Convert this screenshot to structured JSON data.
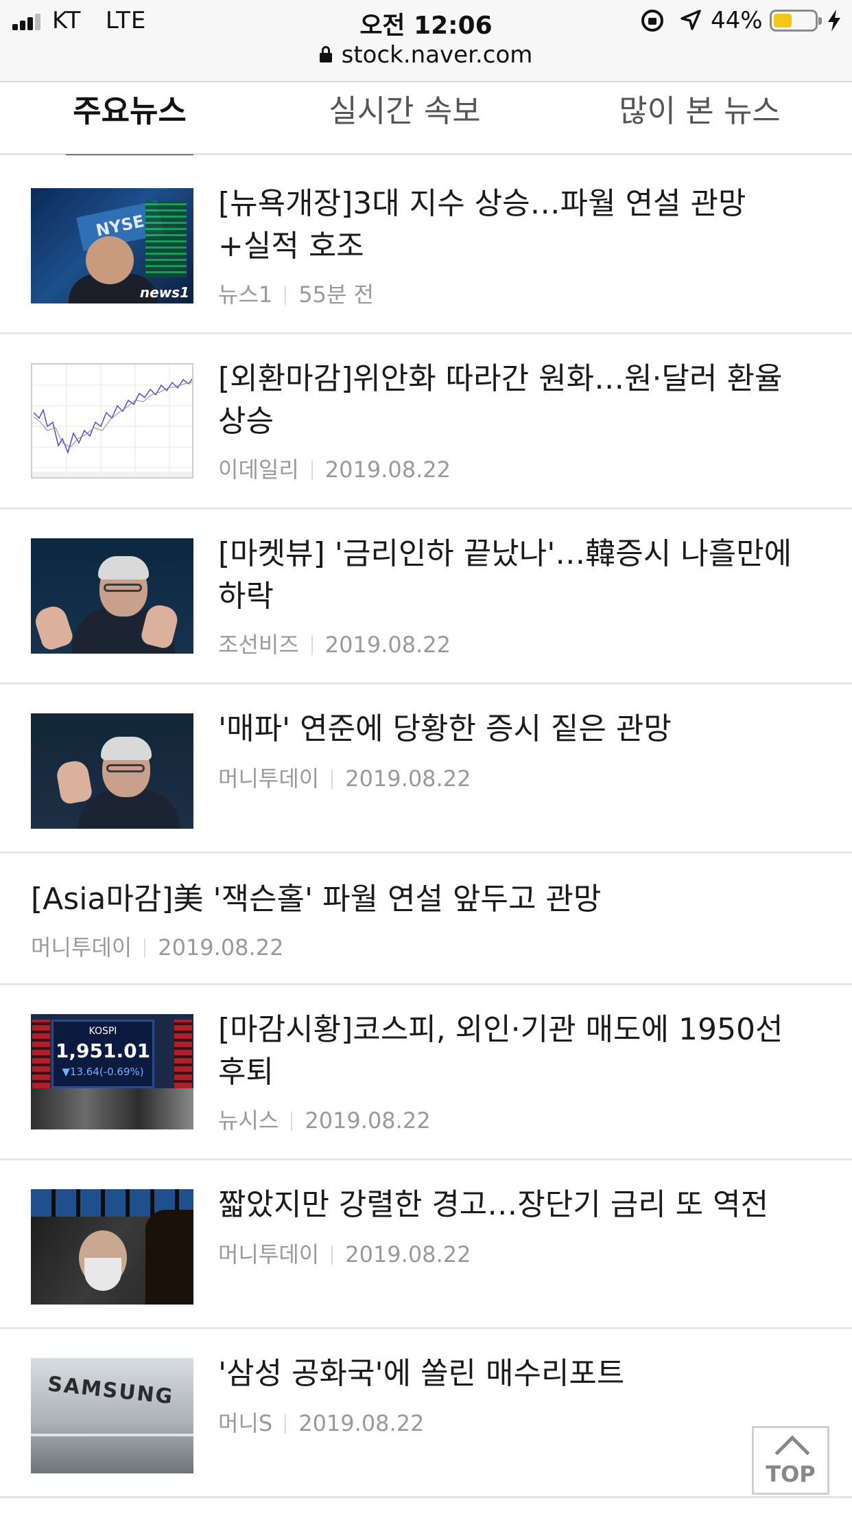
{
  "status_bar": {
    "carrier": "KT",
    "network": "LTE",
    "time": "오전 12:06",
    "battery": "44%",
    "battery_level": 0.44,
    "icons": [
      "signal-icon",
      "orientation-lock-icon",
      "location-icon",
      "battery-icon",
      "charging-bolt-icon"
    ]
  },
  "url_bar": {
    "url": "stock.naver.com",
    "icon": "lock-icon"
  },
  "tabs": [
    {
      "label": "주요뉴스",
      "active": true
    },
    {
      "label": "실시간 속보",
      "active": false
    },
    {
      "label": "많이 본 뉴스",
      "active": false
    }
  ],
  "news": [
    {
      "title": "[뉴욕개장]3대 지수 상승…파월 연설 관망+실적 호조",
      "source": "뉴스1",
      "time": "55분 전",
      "thumb_logo": "news1"
    },
    {
      "title": "[외환마감]위안화 따라간 원화…원·달러 환율 상승",
      "source": "이데일리",
      "time": "2019.08.22"
    },
    {
      "title": "[마켓뷰] '금리인하 끝났나'…韓증시 나흘만에 하락",
      "source": "조선비즈",
      "time": "2019.08.22"
    },
    {
      "title": "'매파' 연준에 당황한 증시 짙은 관망",
      "source": "머니투데이",
      "time": "2019.08.22"
    },
    {
      "title": "[Asia마감]美 '잭슨홀' 파월 연설 앞두고 관망",
      "source": "머니투데이",
      "time": "2019.08.22"
    },
    {
      "title": "[마감시황]코스피, 외인·기관 매도에 1950선 후퇴",
      "source": "뉴시스",
      "time": "2019.08.22",
      "thumb_board": {
        "label": "KOSPI",
        "value": "1,951.01",
        "change": "▼13.64(-0.69%)"
      }
    },
    {
      "title": "짧았지만 강렬한 경고…장단기 금리 또 역전",
      "source": "머니투데이",
      "time": "2019.08.22"
    },
    {
      "title": "'삼성 공화국'에 쏠린 매수리포트",
      "source": "머니S",
      "time": "2019.08.22",
      "thumb_word": "SAMSUNG"
    }
  ],
  "top_button": {
    "label": "TOP"
  }
}
